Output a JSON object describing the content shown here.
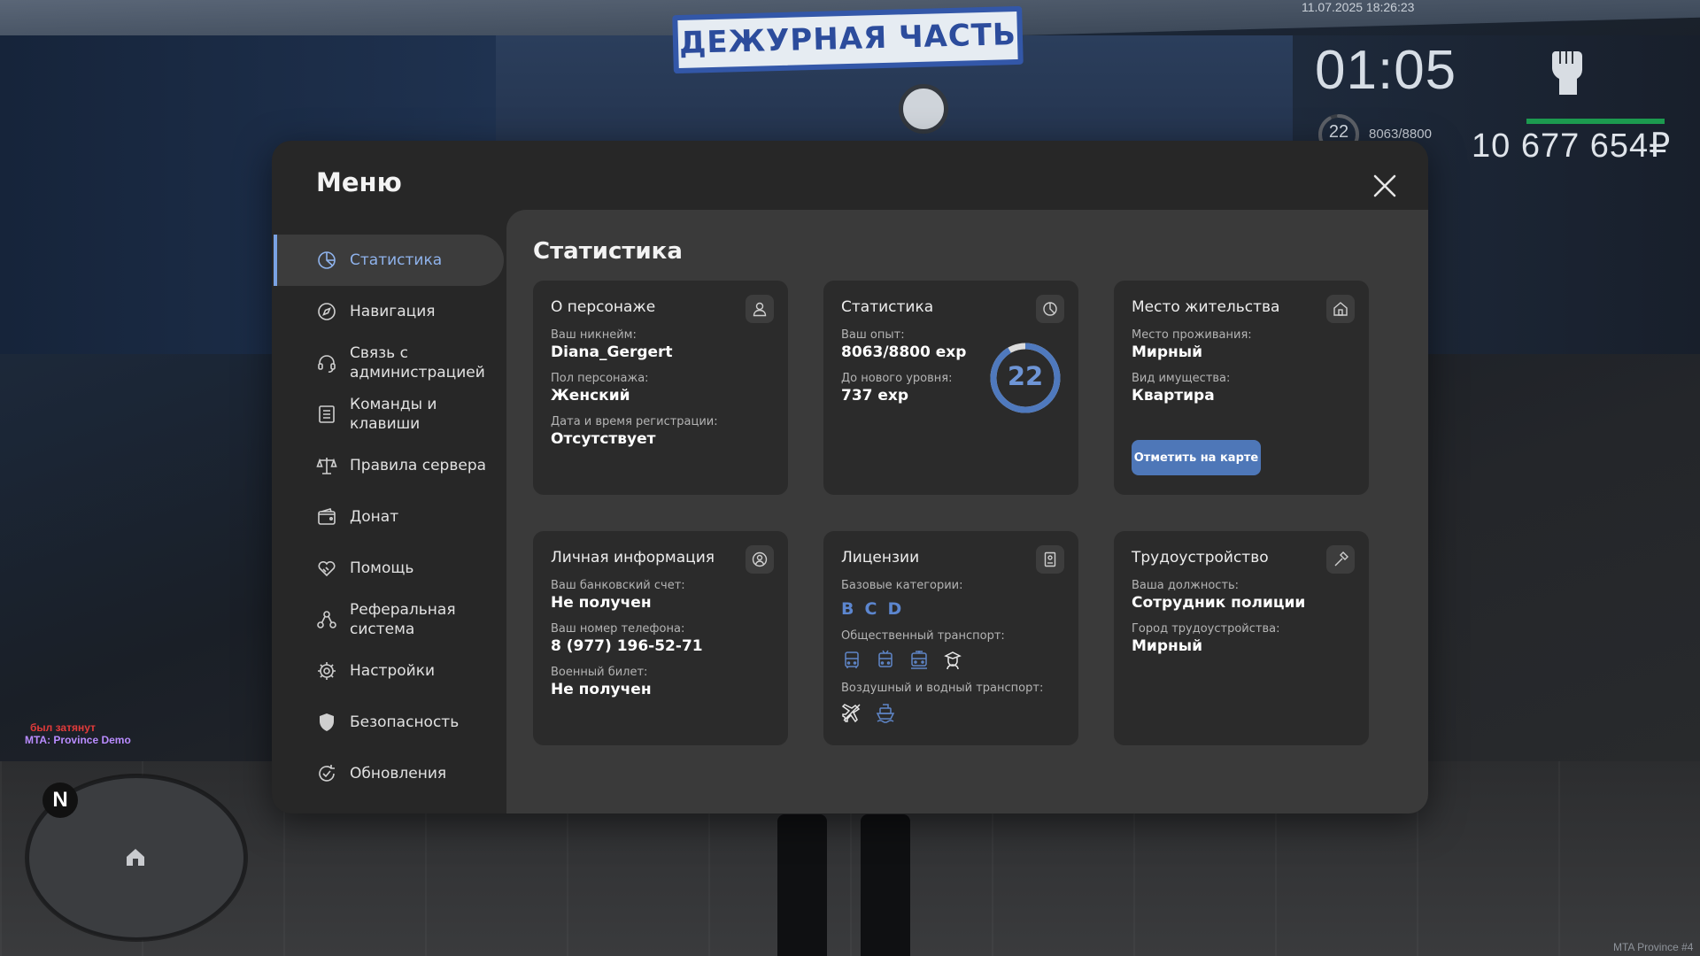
{
  "hud": {
    "datetime": "11.07.2025 18:26:23",
    "time": "01:05",
    "level": "22",
    "exp": "8063/8800",
    "money": "10 677 654₽",
    "health_fraction": 1.0,
    "level_progress_fraction": 0.916,
    "fist_icon": "fist-icon"
  },
  "scene": {
    "sign": "ДЕЖУРНАЯ ЧАСТЬ"
  },
  "chat": {
    "line1": "был затянут",
    "line2": "MTA: Province Demo"
  },
  "radar": {
    "north": "N"
  },
  "watermark": "MTA Province #4",
  "menu": {
    "title": "Меню",
    "close_icon": "close-icon",
    "nav": [
      {
        "label": "Статистика",
        "icon": "pie-chart-icon"
      },
      {
        "label": "Навигация",
        "icon": "compass-icon"
      },
      {
        "label": "Связь с администрацией",
        "icon": "headset-icon"
      },
      {
        "label": "Команды и клавиши",
        "icon": "document-list-icon"
      },
      {
        "label": "Правила сервера",
        "icon": "scales-icon"
      },
      {
        "label": "Донат",
        "icon": "wallet-icon"
      },
      {
        "label": "Помощь",
        "icon": "handshake-heart-icon"
      },
      {
        "label": "Реферальная система",
        "icon": "referral-icon"
      },
      {
        "label": "Настройки",
        "icon": "gear-icon"
      },
      {
        "label": "Безопасность",
        "icon": "shield-icon"
      },
      {
        "label": "Обновления",
        "icon": "refresh-check-icon"
      }
    ],
    "active_index": 0
  },
  "content": {
    "title": "Статистика",
    "about": {
      "title": "О персонаже",
      "icon": "user-icon",
      "nickname_label": "Ваш никнейм:",
      "nickname": "Diana_Gergert",
      "gender_label": "Пол персонажа:",
      "gender": "Женский",
      "reg_label": "Дата и время регистрации:",
      "reg": "Отсутствует"
    },
    "stats": {
      "title": "Статистика",
      "icon": "pie-chart-icon",
      "exp_label": "Ваш опыт:",
      "exp": "8063/8800 exp",
      "next_label": "До нового уровня:",
      "next": "737 exp",
      "level": "22",
      "progress_fraction": 0.916
    },
    "residence": {
      "title": "Место жительства",
      "icon": "house-icon",
      "place_label": "Место проживания:",
      "place": "Мирный",
      "property_label": "Вид имущества:",
      "property": "Квартира",
      "map_button": "Отметить на карте"
    },
    "personal": {
      "title": "Личная информация",
      "icon": "user-circle-icon",
      "bank_label": "Ваш банковский счет:",
      "bank": "Не получен",
      "phone_label": "Ваш номер телефона:",
      "phone": "8 (977) 196-52-71",
      "military_label": "Военный билет:",
      "military": "Не получен"
    },
    "licenses": {
      "title": "Лицензии",
      "icon": "id-card-icon",
      "base_label": "Базовые категории:",
      "base": [
        "B",
        "C",
        "D"
      ],
      "public_label": "Общественный транспорт:",
      "public_icons": [
        "bus-icon",
        "trolleybus-icon",
        "tram-icon",
        "taxi-driver-icon"
      ],
      "air_label": "Воздушный и водный транспорт:",
      "air_icons": [
        "airplane-icon",
        "boat-icon"
      ]
    },
    "job": {
      "title": "Трудоустройство",
      "icon": "hammer-icon",
      "position_label": "Ваша должность:",
      "position": "Сотрудник полиции",
      "city_label": "Город трудоустройства:",
      "city": "Мирный"
    }
  }
}
